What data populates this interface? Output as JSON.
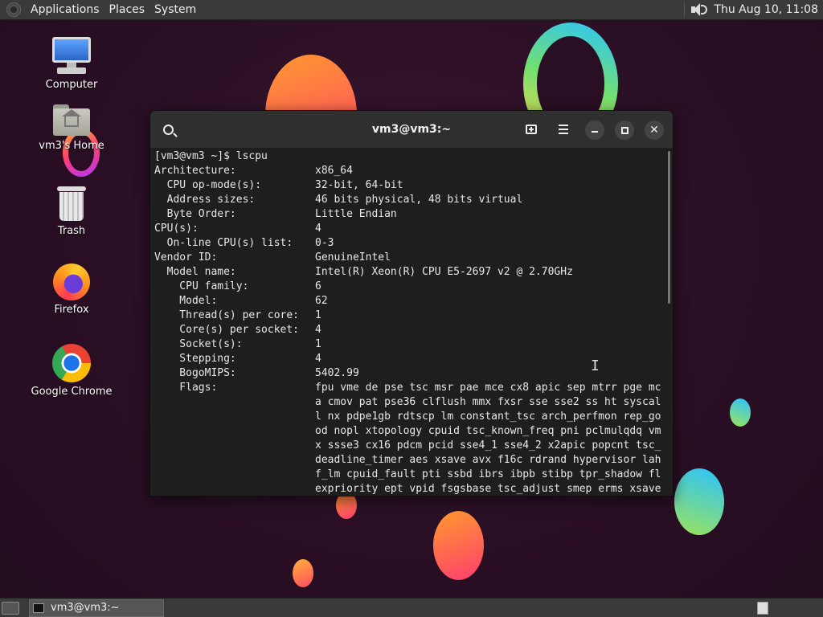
{
  "top_panel": {
    "menus": [
      "Applications",
      "Places",
      "System"
    ],
    "clock": "Thu Aug 10, 11:08"
  },
  "desktop_icons": [
    {
      "label": "Computer",
      "icon": "computer-icon"
    },
    {
      "label": "vm3's Home",
      "icon": "home-folder-icon"
    },
    {
      "label": "Trash",
      "icon": "trash-icon"
    },
    {
      "label": "Firefox",
      "icon": "firefox-icon"
    },
    {
      "label": "Google Chrome",
      "icon": "chrome-icon"
    }
  ],
  "terminal": {
    "title": "vm3@vm3:~",
    "lines": [
      {
        "key": "[vm3@vm3 ~]$ lscpu",
        "value": ""
      },
      {
        "key": "Architecture:",
        "value": "x86_64"
      },
      {
        "key": "  CPU op-mode(s):",
        "value": "32-bit, 64-bit"
      },
      {
        "key": "  Address sizes:",
        "value": "46 bits physical, 48 bits virtual"
      },
      {
        "key": "  Byte Order:",
        "value": "Little Endian"
      },
      {
        "key": "CPU(s):",
        "value": "4"
      },
      {
        "key": "  On-line CPU(s) list:",
        "value": "0-3"
      },
      {
        "key": "Vendor ID:",
        "value": "GenuineIntel"
      },
      {
        "key": "  Model name:",
        "value": "Intel(R) Xeon(R) CPU E5-2697 v2 @ 2.70GHz"
      },
      {
        "key": "    CPU family:",
        "value": "6"
      },
      {
        "key": "    Model:",
        "value": "62"
      },
      {
        "key": "    Thread(s) per core:",
        "value": "1"
      },
      {
        "key": "    Core(s) per socket:",
        "value": "4"
      },
      {
        "key": "    Socket(s):",
        "value": "1"
      },
      {
        "key": "    Stepping:",
        "value": "4"
      },
      {
        "key": "    BogoMIPS:",
        "value": "5402.99"
      },
      {
        "key": "    Flags:",
        "value": "fpu vme de pse tsc msr pae mce cx8 apic sep mtrr pge mc"
      },
      {
        "key": "",
        "value": "a cmov pat pse36 clflush mmx fxsr sse sse2 ss ht syscal"
      },
      {
        "key": "",
        "value": "l nx pdpe1gb rdtscp lm constant_tsc arch_perfmon rep_go"
      },
      {
        "key": "",
        "value": "od nopl xtopology cpuid tsc_known_freq pni pclmulqdq vm"
      },
      {
        "key": "",
        "value": "x ssse3 cx16 pdcm pcid sse4_1 sse4_2 x2apic popcnt tsc_"
      },
      {
        "key": "",
        "value": "deadline_timer aes xsave avx f16c rdrand hypervisor lah"
      },
      {
        "key": "",
        "value": "f_lm cpuid_fault pti ssbd ibrs ibpb stibp tpr_shadow fl"
      },
      {
        "key": "",
        "value": "expriority ept vpid fsgsbase tsc_adjust smep erms xsave"
      }
    ]
  },
  "taskbar": {
    "task_label": "vm3@vm3:~"
  }
}
